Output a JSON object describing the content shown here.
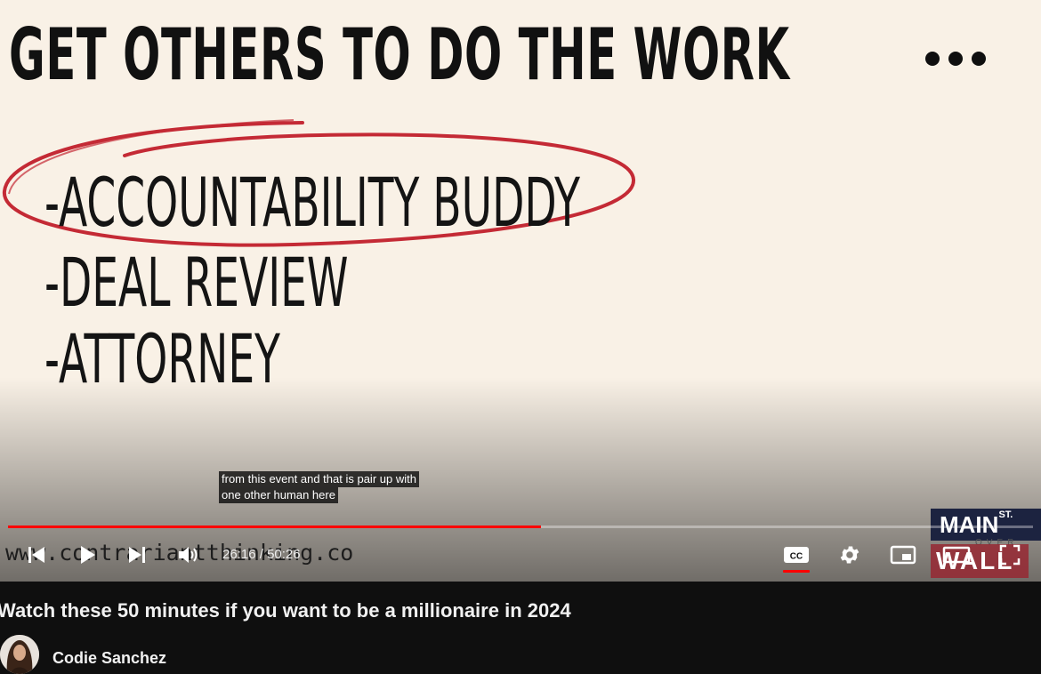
{
  "slide": {
    "title": "GET OTHERS TO DO THE WORK",
    "items": [
      "-ACCOUNTABILITY BUDDY",
      "-DEAL REVIEW",
      "-ATTORNEY"
    ],
    "url_watermark": "www.contrariantthinking.co"
  },
  "logo": {
    "main": "MAIN",
    "st": "ST.",
    "over": "OVER",
    "wall": "WALL"
  },
  "captions": {
    "line1": "from this event and that is pair up with",
    "line2": "one other human here"
  },
  "player": {
    "progress_fraction": 0.52,
    "current_time": "26:16",
    "separator": "/",
    "duration": "50:26",
    "accent_color": "#ff0000"
  },
  "video": {
    "title": "Watch these 50 minutes if you want to be a millionaire in 2024",
    "channel": "Codie Sanchez"
  },
  "icons": [
    "more-icon",
    "previous-icon",
    "play-icon",
    "next-icon",
    "volume-icon",
    "cc-icon",
    "settings-icon",
    "miniplayer-icon",
    "theater-icon",
    "fullscreen-icon"
  ]
}
